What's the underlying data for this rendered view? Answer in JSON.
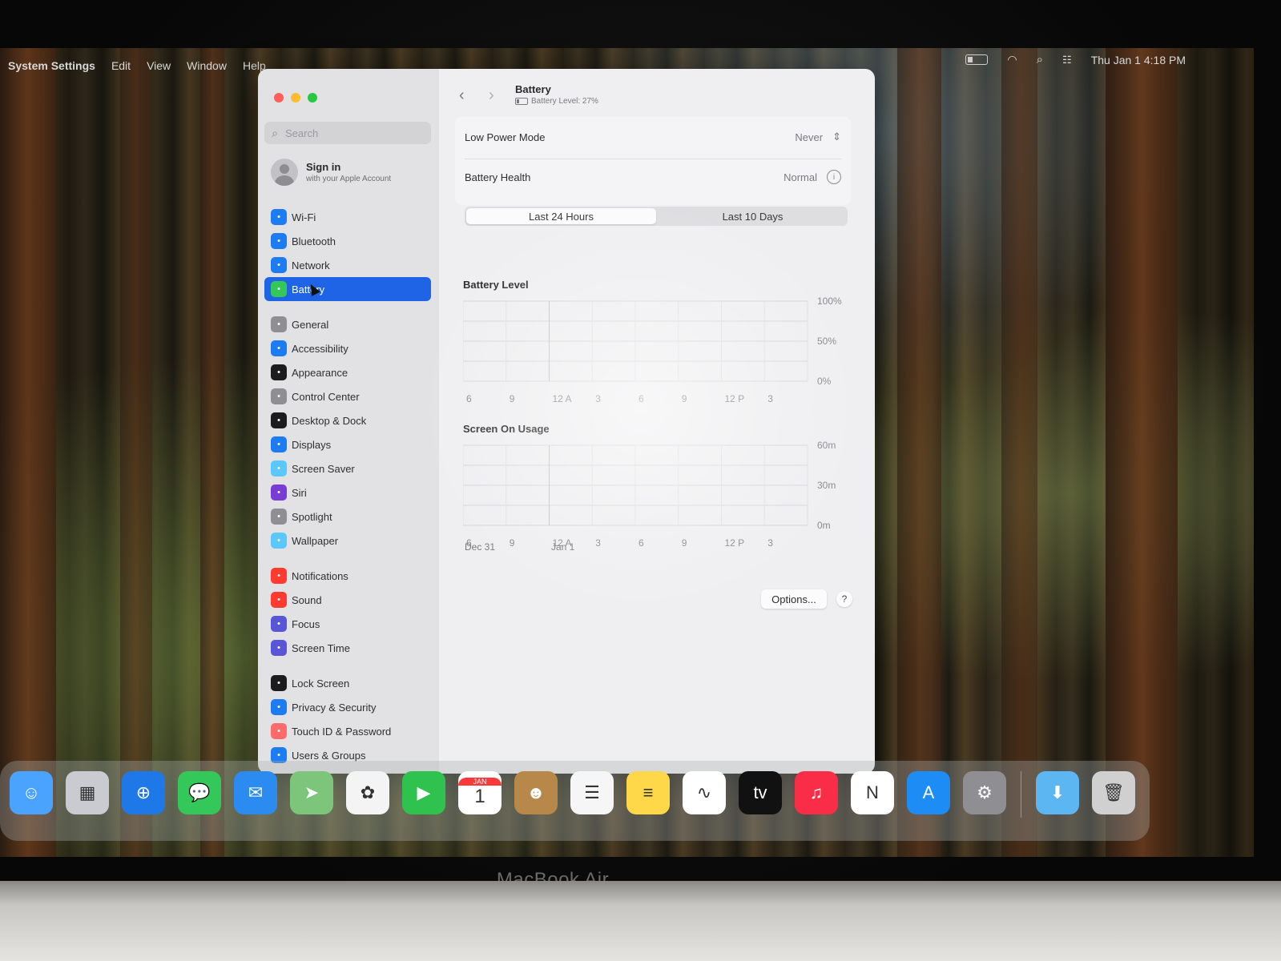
{
  "menubar": {
    "app": "System Settings",
    "items": [
      "Edit",
      "View",
      "Window",
      "Help"
    ],
    "datetime": "Thu Jan 1  4:18 PM",
    "icons": [
      "battery-icon",
      "wifi-icon",
      "search-icon",
      "control-center-icon"
    ]
  },
  "sidebar": {
    "search_placeholder": "Search",
    "signin": {
      "title": "Sign in",
      "subtitle": "with your Apple Account"
    },
    "groups": [
      [
        {
          "label": "Wi-Fi",
          "icon": "wifi-icon",
          "color": "#1e7cf2"
        },
        {
          "label": "Bluetooth",
          "icon": "bluetooth-icon",
          "color": "#1e7cf2"
        },
        {
          "label": "Network",
          "icon": "globe-icon",
          "color": "#1e7cf2"
        },
        {
          "label": "Battery",
          "icon": "battery-icon",
          "color": "#34c759",
          "selected": true
        }
      ],
      [
        {
          "label": "General",
          "icon": "gear-icon",
          "color": "#8e8e93"
        },
        {
          "label": "Accessibility",
          "icon": "accessibility-icon",
          "color": "#1e7cf2"
        },
        {
          "label": "Appearance",
          "icon": "appearance-icon",
          "color": "#1c1c1e"
        },
        {
          "label": "Control Center",
          "icon": "control-center-icon",
          "color": "#8e8e93"
        },
        {
          "label": "Desktop & Dock",
          "icon": "dock-icon",
          "color": "#1c1c1e"
        },
        {
          "label": "Displays",
          "icon": "sun-icon",
          "color": "#1e7cf2"
        },
        {
          "label": "Screen Saver",
          "icon": "screen-saver-icon",
          "color": "#5ac8fa"
        },
        {
          "label": "Siri",
          "icon": "siri-icon",
          "color": "#7a3cd6"
        },
        {
          "label": "Spotlight",
          "icon": "spotlight-icon",
          "color": "#8e8e93"
        },
        {
          "label": "Wallpaper",
          "icon": "wallpaper-icon",
          "color": "#5ac8fa"
        }
      ],
      [
        {
          "label": "Notifications",
          "icon": "bell-icon",
          "color": "#ff3b30"
        },
        {
          "label": "Sound",
          "icon": "speaker-icon",
          "color": "#ff3b30"
        },
        {
          "label": "Focus",
          "icon": "moon-icon",
          "color": "#5856d6"
        },
        {
          "label": "Screen Time",
          "icon": "hourglass-icon",
          "color": "#5856d6"
        }
      ],
      [
        {
          "label": "Lock Screen",
          "icon": "lock-icon",
          "color": "#1c1c1e"
        },
        {
          "label": "Privacy & Security",
          "icon": "hand-icon",
          "color": "#1e7cf2"
        },
        {
          "label": "Touch ID & Password",
          "icon": "fingerprint-icon",
          "color": "#ff6b6b"
        },
        {
          "label": "Users & Groups",
          "icon": "users-icon",
          "color": "#1e7cf2"
        }
      ]
    ]
  },
  "header": {
    "title": "Battery",
    "subtitle": "Battery Level: 27%"
  },
  "settings": {
    "low_power_label": "Low Power Mode",
    "low_power_value": "Never",
    "health_label": "Battery Health",
    "health_value": "Normal"
  },
  "tabs": [
    {
      "label": "Last 24 Hours",
      "selected": true
    },
    {
      "label": "Last 10 Days",
      "selected": false
    }
  ],
  "battery_chart": {
    "title": "Battery Level",
    "y_labels": [
      "100%",
      "50%",
      "0%"
    ],
    "x_labels": [
      "6",
      "9",
      "12 A",
      "3",
      "6",
      "9",
      "12 P",
      "3"
    ]
  },
  "usage_chart": {
    "title": "Screen On Usage",
    "y_labels": [
      "60m",
      "30m",
      "0m"
    ],
    "x_labels": [
      "6",
      "9",
      "12 A",
      "3",
      "6",
      "9",
      "12 P",
      "3"
    ],
    "date_labels": [
      "Dec 31",
      "Jan 1"
    ]
  },
  "footer": {
    "options_label": "Options...",
    "help_label": "?"
  },
  "dock": [
    {
      "name": "finder-icon",
      "color": "#4aa3ff",
      "glyph": "☺"
    },
    {
      "name": "launchpad-icon",
      "color": "#c9cbd0",
      "glyph": "▦"
    },
    {
      "name": "safari-icon",
      "color": "#1e78e8",
      "glyph": "⊕"
    },
    {
      "name": "messages-icon",
      "color": "#34c759",
      "glyph": "💬"
    },
    {
      "name": "mail-icon",
      "color": "#2b8bf0",
      "glyph": "✉"
    },
    {
      "name": "maps-icon",
      "color": "#7cc57a",
      "glyph": "➤"
    },
    {
      "name": "photos-icon",
      "color": "#f4f4f4",
      "glyph": "✿"
    },
    {
      "name": "facetime-icon",
      "color": "#30c24f",
      "glyph": "▶"
    },
    {
      "name": "calendar-icon",
      "color": "#ffffff",
      "glyph": "1",
      "month": "JAN"
    },
    {
      "name": "contacts-icon",
      "color": "#b7884a",
      "glyph": "☻"
    },
    {
      "name": "reminders-icon",
      "color": "#f6f6f6",
      "glyph": "☰"
    },
    {
      "name": "notes-icon",
      "color": "#ffd84a",
      "glyph": "≡"
    },
    {
      "name": "freeform-icon",
      "color": "#ffffff",
      "glyph": "∿"
    },
    {
      "name": "apple-tv-icon",
      "color": "#111111",
      "glyph": "tv"
    },
    {
      "name": "music-icon",
      "color": "#fa2d48",
      "glyph": "♫"
    },
    {
      "name": "news-icon",
      "color": "#ffffff",
      "glyph": "N"
    },
    {
      "name": "app-store-icon",
      "color": "#1d8cf5",
      "glyph": "A"
    },
    {
      "name": "system-settings-icon",
      "color": "#8e8e93",
      "glyph": "⚙"
    },
    {
      "name": "downloads-folder-icon",
      "color": "#5cb6f2",
      "glyph": "⬇"
    },
    {
      "name": "trash-icon",
      "color": "#d0d0d0",
      "glyph": "🗑"
    }
  ],
  "laptop_label": "MacBook Air"
}
